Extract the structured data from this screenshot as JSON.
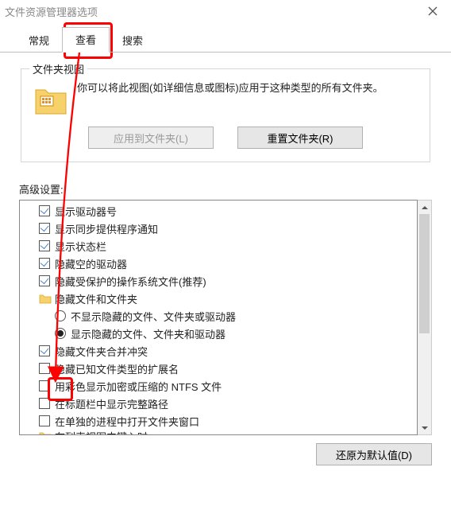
{
  "window": {
    "title": "文件资源管理器选项"
  },
  "tabs": {
    "general": "常规",
    "view": "查看",
    "search": "搜索"
  },
  "folder_views": {
    "group_title": "文件夹视图",
    "description": "你可以将此视图(如详细信息或图标)应用于这种类型的所有文件夹。",
    "apply_btn": "应用到文件夹(L)",
    "reset_btn": "重置文件夹(R)"
  },
  "advanced": {
    "label": "高级设置:",
    "items": [
      {
        "type": "checkbox",
        "checked": true,
        "label": "显示驱动器号"
      },
      {
        "type": "checkbox",
        "checked": true,
        "label": "显示同步提供程序通知"
      },
      {
        "type": "checkbox",
        "checked": true,
        "label": "显示状态栏"
      },
      {
        "type": "checkbox",
        "checked": true,
        "label": "隐藏空的驱动器"
      },
      {
        "type": "checkbox",
        "checked": true,
        "label": "隐藏受保护的操作系统文件(推荐)"
      },
      {
        "type": "folder",
        "checked": false,
        "label": "隐藏文件和文件夹"
      },
      {
        "type": "radio",
        "checked": false,
        "label": "不显示隐藏的文件、文件夹或驱动器"
      },
      {
        "type": "radio",
        "checked": true,
        "label": "显示隐藏的文件、文件夹和驱动器"
      },
      {
        "type": "checkbox",
        "checked": true,
        "label": "隐藏文件夹合并冲突"
      },
      {
        "type": "checkbox",
        "checked": false,
        "label": "隐藏已知文件类型的扩展名"
      },
      {
        "type": "checkbox",
        "checked": false,
        "label": "用彩色显示加密或压缩的 NTFS 文件"
      },
      {
        "type": "checkbox",
        "checked": false,
        "label": "在标题栏中显示完整路径"
      },
      {
        "type": "checkbox",
        "checked": false,
        "label": "在单独的进程中打开文件夹窗口"
      }
    ],
    "cutoff_label": "在列表视图中键入时"
  },
  "restore_btn": "还原为默认值(D)"
}
